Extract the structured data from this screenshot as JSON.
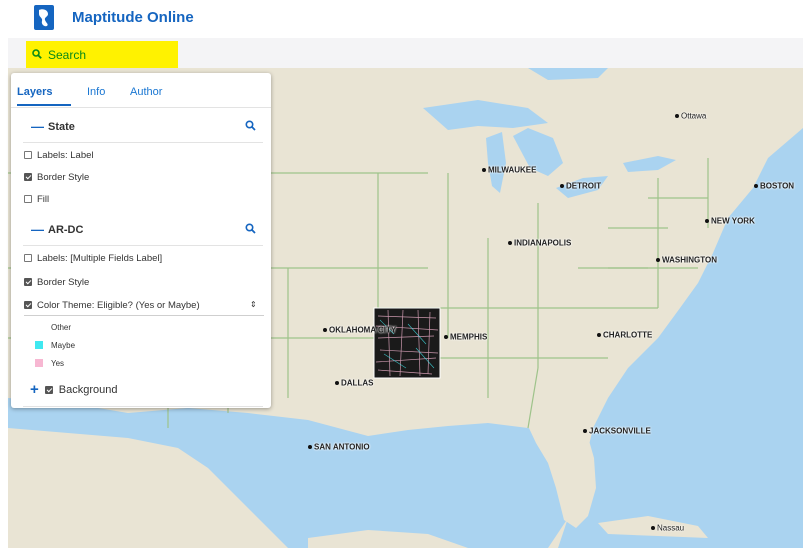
{
  "app": {
    "title": "Maptitude Online"
  },
  "search": {
    "label": "Search"
  },
  "panel": {
    "tabs": [
      {
        "label": "Layers"
      },
      {
        "label": "Info"
      },
      {
        "label": "Author"
      }
    ],
    "layers": [
      {
        "name": "State",
        "options": [
          {
            "label": "Labels: Label",
            "checked": false
          },
          {
            "label": "Border Style",
            "checked": true
          },
          {
            "label": "Fill",
            "checked": false
          }
        ]
      },
      {
        "name": "AR-DC",
        "options": [
          {
            "label": "Labels: [Multiple Fields Label]",
            "checked": false
          },
          {
            "label": "Border Style",
            "checked": true
          },
          {
            "label": "Color Theme: Eligible? (Yes or Maybe)",
            "checked": true
          }
        ],
        "legend": [
          {
            "label": "Other",
            "color": "#ffffff"
          },
          {
            "label": "Maybe",
            "color": "#40e8f0"
          },
          {
            "label": "Yes",
            "color": "#f7b7d2"
          }
        ]
      }
    ],
    "background": {
      "label": "Background",
      "checked": true
    }
  },
  "map": {
    "colors": {
      "land": "#e9e4d4",
      "water": "#aad3f0",
      "border": "#9ec38a"
    },
    "cities": [
      {
        "name": "Ottawa"
      },
      {
        "name": "MILWAUKEE"
      },
      {
        "name": "DETROIT"
      },
      {
        "name": "BOSTON"
      },
      {
        "name": "NEW YORK"
      },
      {
        "name": "INDIANAPOLIS"
      },
      {
        "name": "WASHINGTON"
      },
      {
        "name": "OKLAHOMA CITY"
      },
      {
        "name": "MEMPHIS"
      },
      {
        "name": "CHARLOTTE"
      },
      {
        "name": "DALLAS"
      },
      {
        "name": "JACKSONVILLE"
      },
      {
        "name": "SAN ANTONIO"
      },
      {
        "name": "Nassau"
      }
    ]
  }
}
